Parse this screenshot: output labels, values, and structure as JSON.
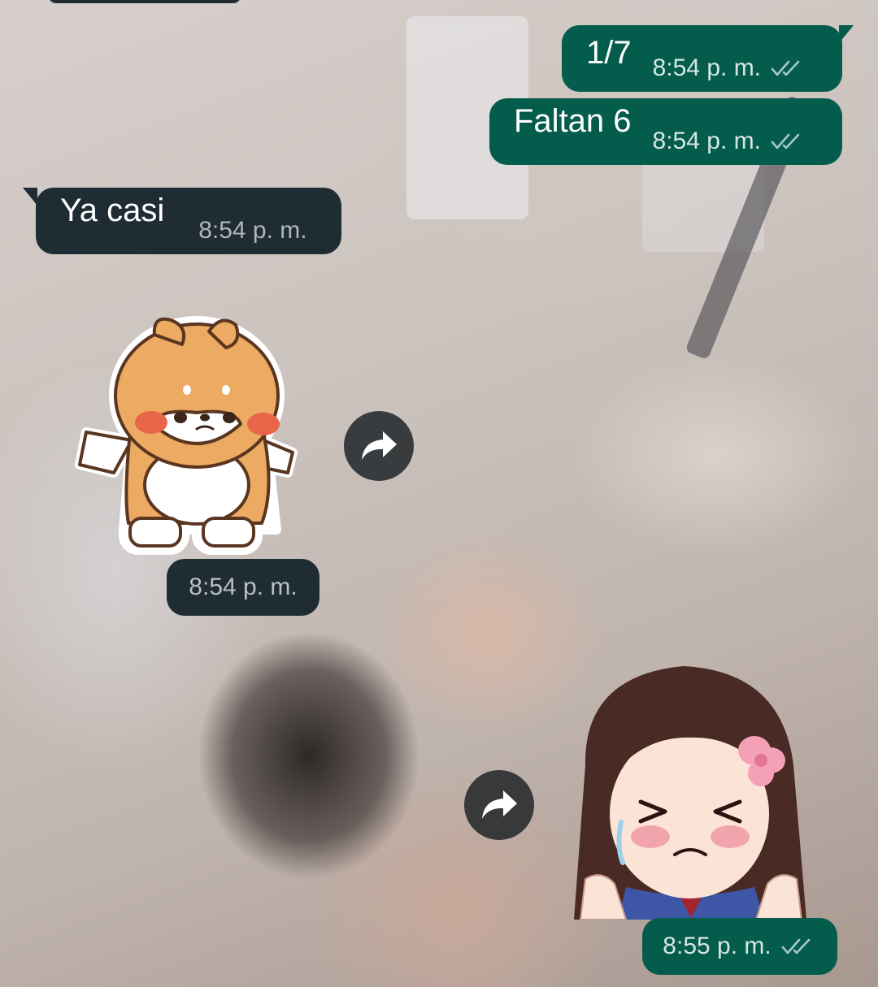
{
  "messages": [
    {
      "id": "m1",
      "direction": "out",
      "text": "1/7",
      "time": "8:54 p. m.",
      "status": "read"
    },
    {
      "id": "m2",
      "direction": "out",
      "text": "Faltan 6",
      "time": "8:54 p. m.",
      "status": "read"
    },
    {
      "id": "m3",
      "direction": "in",
      "text": "Ya casi",
      "time": "8:54 p. m."
    },
    {
      "id": "m4",
      "direction": "in",
      "type": "sticker",
      "sticker": "shiba-dog-sticker",
      "time": "8:54 p. m."
    },
    {
      "id": "m5",
      "direction": "out",
      "type": "sticker",
      "sticker": "crying-anime-girl-sticker",
      "time": "8:55 p. m.",
      "status": "read"
    }
  ],
  "icons": {
    "forward": "forward-icon",
    "read_receipt": "double-check-icon"
  },
  "colors": {
    "outgoing_bubble": "#045c4c",
    "incoming_bubble": "#1f2c34",
    "read_ticks": "#a8c4d2"
  }
}
